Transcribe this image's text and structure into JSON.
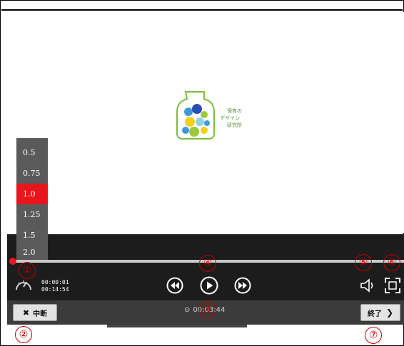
{
  "logo": {
    "line1": "保育の",
    "line2": "デザイン",
    "line3": "研究所"
  },
  "speed_menu": {
    "options": [
      "0.5",
      "0.75",
      "1.0",
      "1.25",
      "1.5",
      "2.0"
    ],
    "selected": "1.0"
  },
  "player": {
    "progress_fraction": 0.0,
    "current_time": "00:00:01",
    "duration": "00:14:54"
  },
  "footer": {
    "stop_label": "中断",
    "end_label": "終了",
    "elapsed": "00:03:44"
  },
  "badges": [
    "①",
    "②",
    "③",
    "④",
    "⑤",
    "⑥",
    "⑦"
  ],
  "colors": {
    "accent": "#e8161c",
    "badge": "#c40000",
    "player_bg": "#1c1c1c",
    "footer_bg": "#3b3b3b"
  }
}
